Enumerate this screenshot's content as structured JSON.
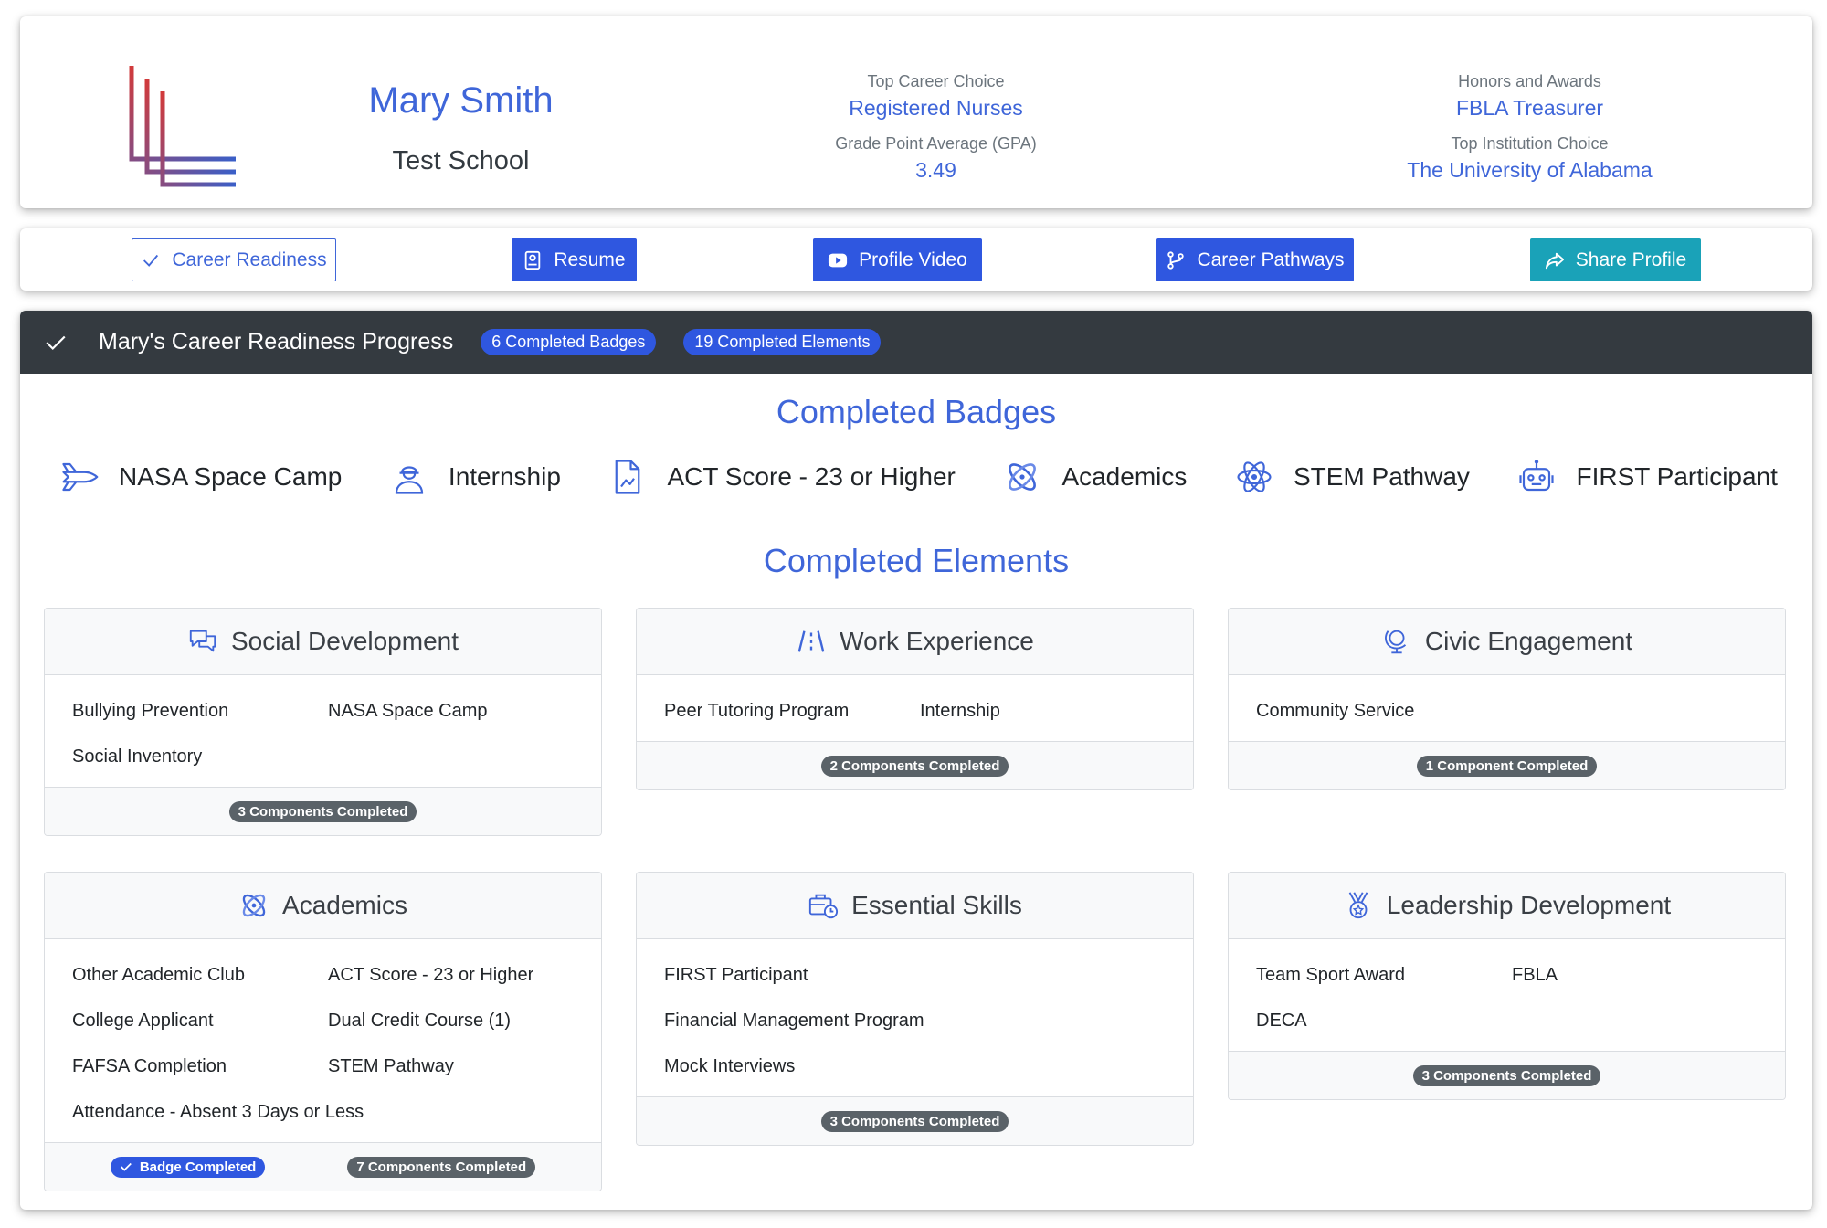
{
  "profile": {
    "name": "Mary Smith",
    "school": "Test School",
    "top_career_label": "Top Career Choice",
    "top_career_value": "Registered Nurses",
    "gpa_label": "Grade Point Average (GPA)",
    "gpa_value": "3.49",
    "honors_label": "Honors and Awards",
    "honors_value": "FBLA Treasurer",
    "institution_label": "Top Institution Choice",
    "institution_value": "The University of Alabama"
  },
  "nav": {
    "career_readiness": "Career Readiness",
    "resume": "Resume",
    "profile_video": "Profile Video",
    "career_pathways": "Career Pathways",
    "share_profile": "Share Profile"
  },
  "progress": {
    "title": "Mary's Career Readiness Progress",
    "badges_pill": "6 Completed Badges",
    "elements_pill": "19 Completed Elements",
    "badges_heading": "Completed Badges",
    "elements_heading": "Completed Elements"
  },
  "badges": [
    {
      "label": "NASA Space Camp",
      "icon": "space-shuttle-icon"
    },
    {
      "label": "Internship",
      "icon": "worker-icon"
    },
    {
      "label": "ACT Score - 23 or Higher",
      "icon": "document-chart-icon"
    },
    {
      "label": "Academics",
      "icon": "atom-orbit-icon"
    },
    {
      "label": "STEM Pathway",
      "icon": "atom-icon"
    },
    {
      "label": "FIRST Participant",
      "icon": "robot-icon"
    }
  ],
  "elements": {
    "social": {
      "title": "Social Development",
      "items": [
        "Bullying Prevention",
        "NASA Space Camp",
        "Social Inventory"
      ],
      "count": "3 Components Completed"
    },
    "work": {
      "title": "Work Experience",
      "items": [
        "Peer Tutoring Program",
        "Internship"
      ],
      "count": "2 Components Completed"
    },
    "civic": {
      "title": "Civic Engagement",
      "items": [
        "Community Service"
      ],
      "count": "1 Component Completed"
    },
    "academics": {
      "title": "Academics",
      "items": [
        "Other Academic Club",
        "ACT Score - 23 or Higher",
        "College Applicant",
        "Dual Credit Course (1)",
        "FAFSA Completion",
        "STEM Pathway",
        "Attendance - Absent 3 Days or Less"
      ],
      "badge": "Badge Completed",
      "count": "7 Components Completed"
    },
    "essential": {
      "title": "Essential Skills",
      "items": [
        "FIRST Participant",
        "Financial Management Program",
        "Mock Interviews"
      ],
      "count": "3 Components Completed"
    },
    "leadership": {
      "title": "Leadership Development",
      "items": [
        "Team Sport Award",
        "FBLA",
        "DECA"
      ],
      "count": "3 Components Completed"
    }
  },
  "colors": {
    "accent": "#3f66d9",
    "button_blue": "#2f57e0",
    "share_teal": "#1aa2b8",
    "header_dark": "#343a40",
    "count_gray": "#5a6268"
  }
}
